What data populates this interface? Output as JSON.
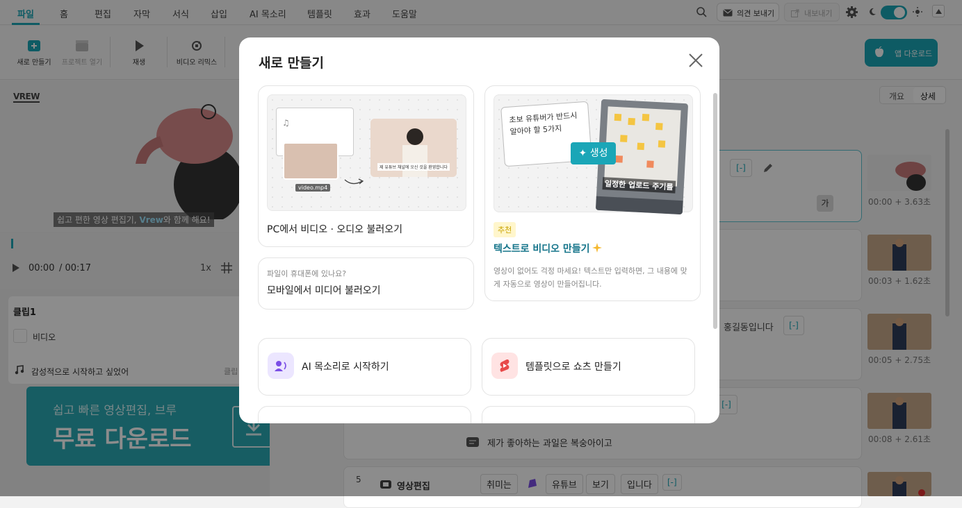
{
  "menu": {
    "items": [
      "파일",
      "홈",
      "편집",
      "자막",
      "서식",
      "삽입",
      "AI 목소리",
      "템플릿",
      "효과",
      "도움말"
    ],
    "active_index": 0
  },
  "header": {
    "feedback_label": "의견 보내기",
    "export_label": "내보내기"
  },
  "toolbar": {
    "new_label": "새로 만들기",
    "open_label": "프로젝트 열기",
    "play_label": "재생",
    "remix_label": "비디오 리믹스",
    "app_download_label": "앱 다운로드"
  },
  "preview": {
    "logo": "VREW",
    "subtitle_prefix": "쉽고 편한 영상 편집기, ",
    "subtitle_brand": "Vrew",
    "subtitle_suffix": "와 함께 해요!"
  },
  "player": {
    "current_time": "00:00",
    "total_time": "/ 00:17",
    "speed": "1x"
  },
  "clip_panel": {
    "title": "클립1",
    "video_label": "비디오",
    "music_label": "감성적으로 시작하고 싶었어",
    "clip_tag": "클립"
  },
  "banner": {
    "line1": "쉽고 빠른 영상편집, 브루",
    "line2": "무료 다운로드"
  },
  "view_toggle": {
    "overview": "개요",
    "detail": "상세"
  },
  "rows": [
    {
      "thumb_time": "00:00 + 3.63초"
    },
    {
      "thumb_time": "00:03 + 1.62초"
    },
    {
      "thumb_time": "00:05 + 2.75초",
      "text": "홍길동입니다"
    },
    {
      "thumb_time": "00:08 + 2.61초",
      "text": "제가 좋아하는 과일은 복숭아이고"
    },
    {
      "index": "5",
      "label": "영상편집",
      "words": [
        "취미는",
        "유튜브",
        "보기",
        "입니다"
      ]
    }
  ],
  "bracket_token": "[-]",
  "ga_char": "가",
  "modal": {
    "title": "새로 만들기",
    "card_pc": {
      "label": "PC에서 비디오 · 오디오 불러오기",
      "file_tag": "video.mp4",
      "caption": "제 유튜브 채널에 오신 것을 환영합니다"
    },
    "card_text": {
      "badge": "추천",
      "title": "텍스트로 비디오 만들기",
      "desc": "영상이 없어도 걱정 마세요! 텍스트만 입력하면, 그 내용에 맞게 자동으로 영상이 만들어집니다.",
      "note_text": "초보 유튜버가 반드시 알아야 할 5가지",
      "generate_label": "생성",
      "photo_caption": "일정한 업로드 주기를"
    },
    "card_mobile": {
      "sub": "파일이 휴대폰에 있나요?",
      "title": "모바일에서 미디어 불러오기"
    },
    "option_ai": {
      "label": "AI 목소리로 시작하기"
    },
    "option_template": {
      "label": "템플릿으로 쇼츠 만들기"
    }
  },
  "colors": {
    "accent": "#1aa6b7",
    "badge_bg": "#fff6cc",
    "badge_fg": "#c9a300",
    "title_teal": "#14748a"
  }
}
